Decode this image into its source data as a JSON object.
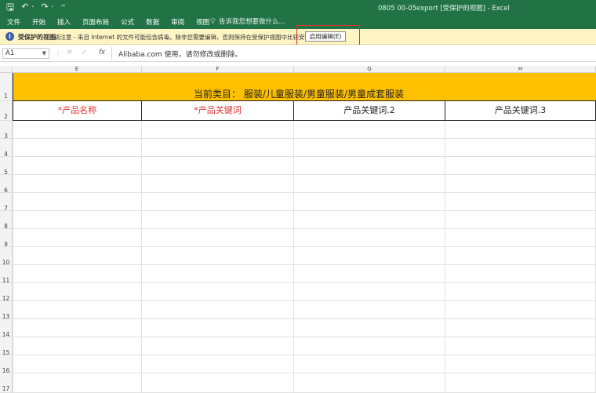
{
  "titlebar": {
    "quick_access": {
      "save": "🖫",
      "undo": "↶ ·",
      "redo": "↷ ·",
      "custom": "⁼"
    },
    "title": "0805 00-05export  [受保护的视图] - Excel"
  },
  "ribbon": {
    "tabs": [
      "文件",
      "开始",
      "插入",
      "页面布局",
      "公式",
      "数据",
      "审阅",
      "视图"
    ],
    "tell_me": "告诉我您想要做什么..."
  },
  "protected_view": {
    "title": "受保护的视图",
    "message": "请注意 - 来自 Internet 的文件可能包含病毒。除非您需要编辑，否则保持在受保护视图中比较安全。",
    "enable_button": "启用编辑(E)"
  },
  "formula_bar": {
    "name_box": "A1",
    "fx_label": "fx",
    "content": "Alibaba.com 使用，请勿修改或删除。"
  },
  "columns": [
    "E",
    "F",
    "G",
    "H"
  ],
  "rows": [
    "1",
    "2",
    "3",
    "4",
    "5",
    "6",
    "7",
    "8",
    "9",
    "10",
    "11",
    "12",
    "13",
    "14",
    "15",
    "16",
    "17"
  ],
  "sheet": {
    "category_text": "当前类目：  服装/儿童服装/男童服装/男童成套服装",
    "headers": [
      "*产品名称",
      "*产品关键词",
      "产品关键词.2",
      "产品关键词.3"
    ]
  },
  "colors": {
    "excel_green": "#217346",
    "category_fill": "#ffc000",
    "required_red": "#e03131",
    "protected_bar": "#fff5c4"
  }
}
